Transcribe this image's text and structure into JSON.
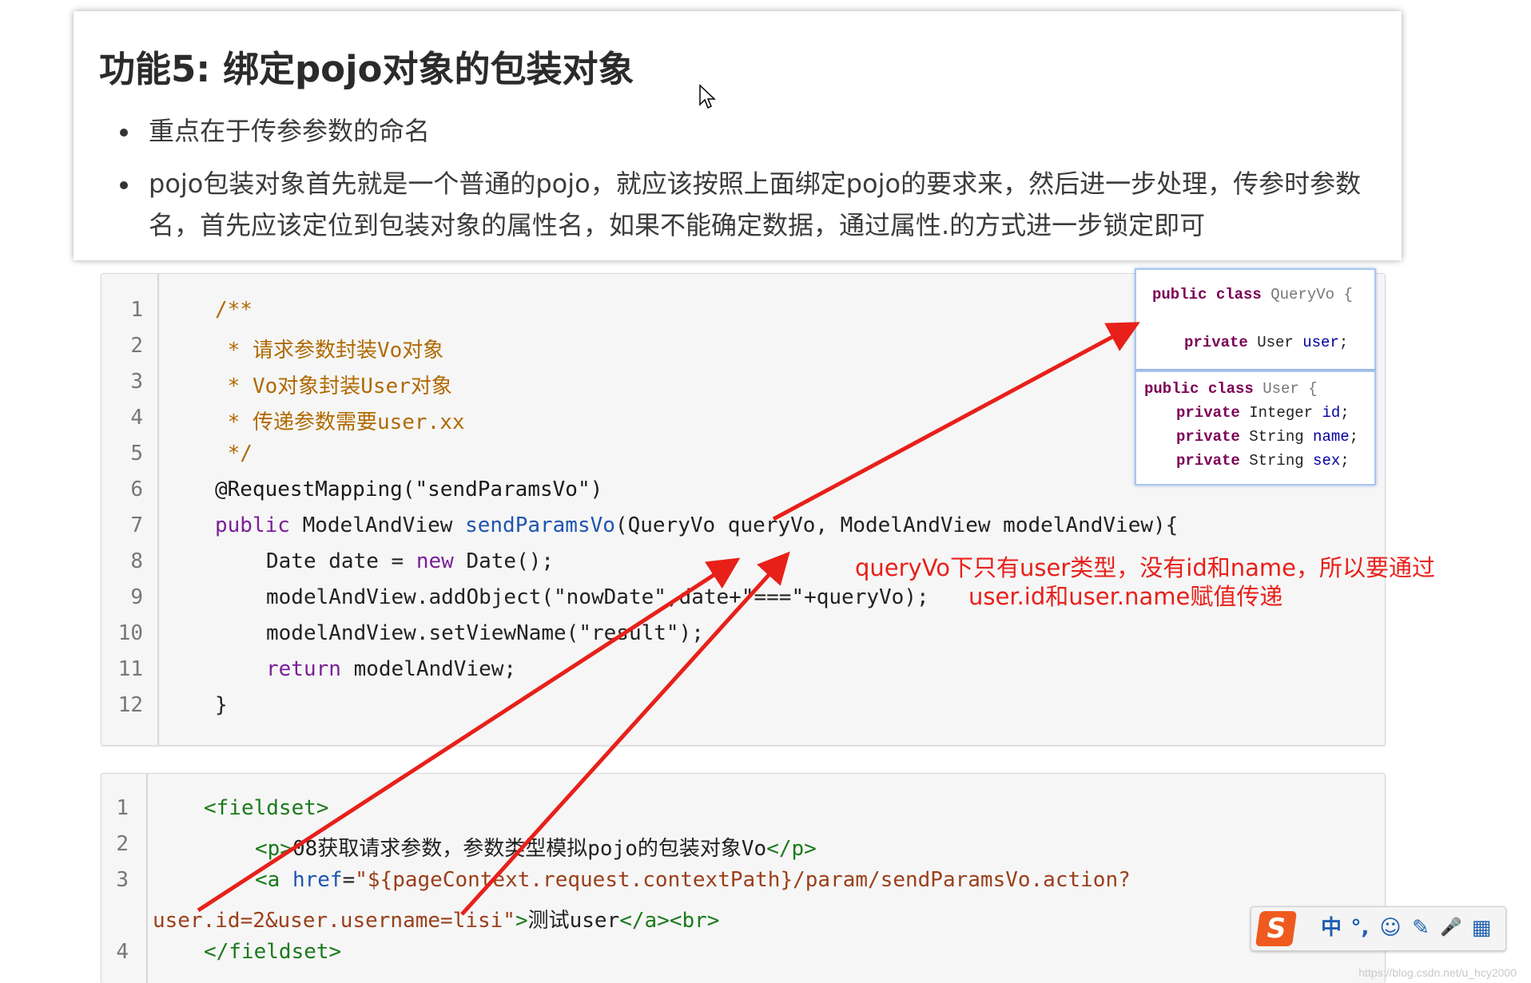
{
  "title": "功能5: 绑定pojo对象的包装对象",
  "bullets": [
    "重点在于传参参数的命名",
    "pojo包装对象首先就是一个普通的pojo，就应该按照上面绑定pojo的要求来，然后进一步处理，传参时参数名，首先应该定位到包装对象的属性名，如果不能确定数据，通过属性.的方式进一步锁定即可"
  ],
  "code_java": {
    "line_numbers": [
      "1",
      "2",
      "3",
      "4",
      "5",
      "6",
      "7",
      "8",
      "9",
      "10",
      "11",
      "12"
    ],
    "l1": "/**",
    "l2": " * 请求参数封装Vo对象",
    "l3": " * Vo对象封装User对象",
    "l4": " * 传递参数需要user.xx",
    "l5": " */",
    "l6": "@RequestMapping(\"sendParamsVo\")",
    "l7_kw": "public",
    "l7_type": " ModelAndView ",
    "l7_fn": "sendParamsVo",
    "l7_rest": "(QueryVo queryVo, ModelAndView modelAndView){",
    "l8_a": "Date date = ",
    "l8_kw": "new",
    "l8_b": " Date();",
    "l9": "modelAndView.addObject(\"nowDate\",date+\"===\"+queryVo);",
    "l10": "modelAndView.setViewName(\"result\");",
    "l11_kw": "return",
    "l11_b": " modelAndView;",
    "l12": "}"
  },
  "code_jsp": {
    "line_numbers": [
      "1",
      "2",
      "3",
      "",
      "4"
    ],
    "l1": "<fieldset>",
    "l2_open": "<p>",
    "l2_text": "08获取请求参数，参数类型模拟pojo的包装对象Vo",
    "l2_close": "</p>",
    "l3_tag": "<a ",
    "l3_attr": "href",
    "l3_eq": "=",
    "l3_val": "\"${pageContext.request.contextPath}/param/sendParamsVo.action?",
    "l3b_val": "user.id=2&user.username=lisi\"",
    "l3b_gt": ">",
    "l3b_text": "测试user",
    "l3b_close": "</a><br>",
    "l4": "</fieldset>"
  },
  "popup_queryvo": {
    "line1_kw": "public class",
    "line1_name": " QueryVo {",
    "line2_kw": "private",
    "line2_type": " User ",
    "line2_field": "user",
    "line2_end": ";"
  },
  "popup_user": {
    "line1_kw": "public class",
    "line1_name": " User {",
    "fields": [
      {
        "kw": "private",
        "type": " Integer ",
        "name": "id"
      },
      {
        "kw": "private",
        "type": " String ",
        "name": "name"
      },
      {
        "kw": "private",
        "type": " String ",
        "name": "sex"
      }
    ]
  },
  "annotation": {
    "line1": "queryVo下只有user类型，没有id和name，所以要通过",
    "line2": "user.id和user.name赋值传递"
  },
  "ime": {
    "logo": "S",
    "items": [
      "中",
      "°,",
      "☺",
      "✎",
      "🎤",
      "▦"
    ]
  },
  "watermark": "https://blog.csdn.net/u_hcy2000",
  "colors": {
    "arrow": "#e8201a",
    "popup_border": "#a9c6ee",
    "ime_logo": "#ef5a1e"
  }
}
